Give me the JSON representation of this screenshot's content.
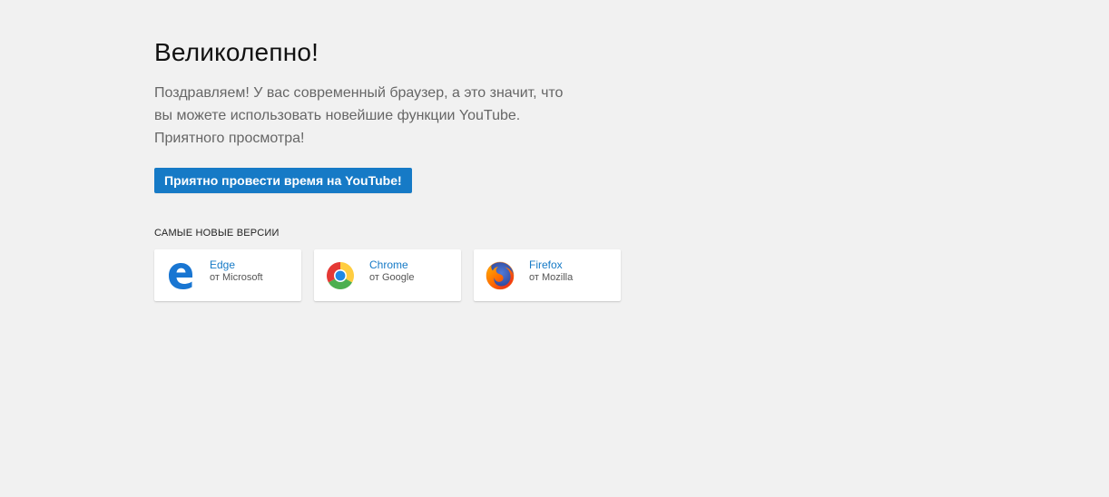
{
  "hero": {
    "title": "Великолепно!",
    "description": "Поздравляем! У вас современный браузер, а это значит, что вы можете использовать новейшие функции YouTube. Приятного просмотра!",
    "cta_label": "Приятно провести время на YouTube!"
  },
  "colors": {
    "background": "#f1f1f1",
    "accent": "#167ac6",
    "title": "#111111",
    "text": "#666666"
  },
  "browsers_section": {
    "label": "САМЫЕ НОВЫЕ ВЕРСИИ",
    "items": [
      {
        "name": "Edge",
        "vendor": "от Microsoft",
        "icon": "edge-icon"
      },
      {
        "name": "Chrome",
        "vendor": "от Google",
        "icon": "chrome-icon"
      },
      {
        "name": "Firefox",
        "vendor": "от Mozilla",
        "icon": "firefox-icon"
      }
    ]
  }
}
